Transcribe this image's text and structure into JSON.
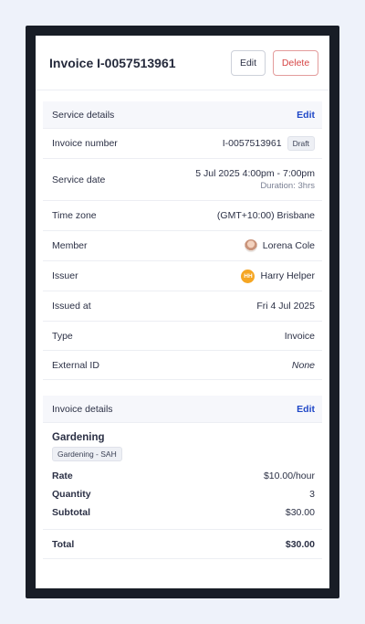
{
  "header": {
    "title": "Invoice I-0057513961",
    "edit_label": "Edit",
    "delete_label": "Delete"
  },
  "service": {
    "title": "Service details",
    "edit_label": "Edit",
    "rows": {
      "invoice_number": {
        "label": "Invoice number",
        "value": "I-0057513961",
        "badge": "Draft"
      },
      "service_date": {
        "label": "Service date",
        "value": "5 Jul 2025 4:00pm - 7:00pm",
        "duration_label": "Duration:",
        "duration_value": "3hrs"
      },
      "time_zone": {
        "label": "Time zone",
        "value": "(GMT+10:00) Brisbane"
      },
      "member": {
        "label": "Member",
        "value": "Lorena Cole"
      },
      "issuer": {
        "label": "Issuer",
        "value": "Harry Helper",
        "initials": "HH"
      },
      "issued_at": {
        "label": "Issued at",
        "value": "Fri 4 Jul 2025"
      },
      "type": {
        "label": "Type",
        "value": "Invoice"
      },
      "external_id": {
        "label": "External ID",
        "value": "None"
      }
    }
  },
  "invoice": {
    "title": "Invoice details",
    "edit_label": "Edit",
    "item": {
      "name": "Gardening",
      "tag": "Gardening - SAH"
    },
    "rate": {
      "label": "Rate",
      "value": "$10.00/hour"
    },
    "quantity": {
      "label": "Quantity",
      "value": "3"
    },
    "subtotal": {
      "label": "Subtotal",
      "value": "$30.00"
    },
    "total": {
      "label": "Total",
      "value": "$30.00"
    }
  },
  "colors": {
    "accent": "#1f47c7",
    "danger": "#d64545",
    "issuer_avatar": "#f5a623"
  }
}
